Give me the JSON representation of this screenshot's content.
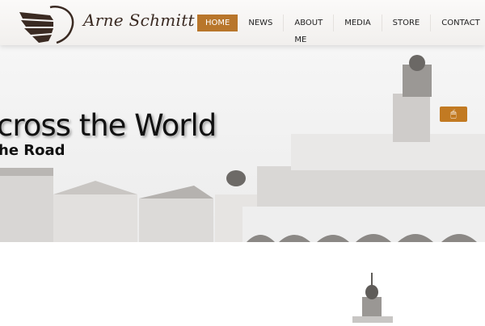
{
  "brand": {
    "name": "Arne Schmitt",
    "logo_icon": "wing-icon"
  },
  "nav": {
    "items": [
      {
        "label": "HOME",
        "active": true
      },
      {
        "label": "NEWS"
      },
      {
        "label": "ABOUT ME"
      },
      {
        "label": "MEDIA"
      },
      {
        "label": "STORE"
      },
      {
        "label": "CONTACT"
      }
    ]
  },
  "hero": {
    "title": "cross the World",
    "subtitle": "he Road",
    "control_icon": "mouse-icon",
    "accent": "#c27a22"
  }
}
